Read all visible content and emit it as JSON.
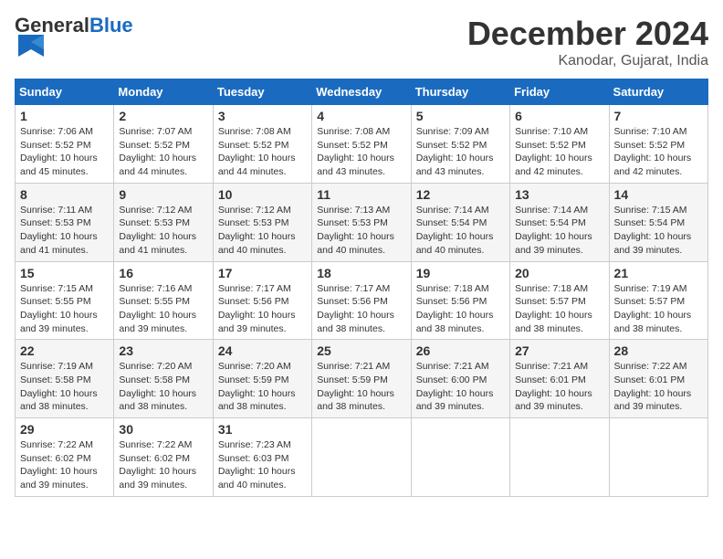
{
  "header": {
    "logo_general": "General",
    "logo_blue": "Blue",
    "month_title": "December 2024",
    "location": "Kanodar, Gujarat, India"
  },
  "calendar": {
    "days_of_week": [
      "Sunday",
      "Monday",
      "Tuesday",
      "Wednesday",
      "Thursday",
      "Friday",
      "Saturday"
    ],
    "weeks": [
      [
        null,
        null,
        null,
        null,
        null,
        null,
        null
      ]
    ],
    "cells": [
      {
        "date": 1,
        "dow": 0,
        "sunrise": "7:06 AM",
        "sunset": "5:52 PM",
        "daylight": "10 hours and 45 minutes."
      },
      {
        "date": 2,
        "dow": 1,
        "sunrise": "7:07 AM",
        "sunset": "5:52 PM",
        "daylight": "10 hours and 44 minutes."
      },
      {
        "date": 3,
        "dow": 2,
        "sunrise": "7:08 AM",
        "sunset": "5:52 PM",
        "daylight": "10 hours and 44 minutes."
      },
      {
        "date": 4,
        "dow": 3,
        "sunrise": "7:08 AM",
        "sunset": "5:52 PM",
        "daylight": "10 hours and 43 minutes."
      },
      {
        "date": 5,
        "dow": 4,
        "sunrise": "7:09 AM",
        "sunset": "5:52 PM",
        "daylight": "10 hours and 43 minutes."
      },
      {
        "date": 6,
        "dow": 5,
        "sunrise": "7:10 AM",
        "sunset": "5:52 PM",
        "daylight": "10 hours and 42 minutes."
      },
      {
        "date": 7,
        "dow": 6,
        "sunrise": "7:10 AM",
        "sunset": "5:52 PM",
        "daylight": "10 hours and 42 minutes."
      },
      {
        "date": 8,
        "dow": 0,
        "sunrise": "7:11 AM",
        "sunset": "5:53 PM",
        "daylight": "10 hours and 41 minutes."
      },
      {
        "date": 9,
        "dow": 1,
        "sunrise": "7:12 AM",
        "sunset": "5:53 PM",
        "daylight": "10 hours and 41 minutes."
      },
      {
        "date": 10,
        "dow": 2,
        "sunrise": "7:12 AM",
        "sunset": "5:53 PM",
        "daylight": "10 hours and 40 minutes."
      },
      {
        "date": 11,
        "dow": 3,
        "sunrise": "7:13 AM",
        "sunset": "5:53 PM",
        "daylight": "10 hours and 40 minutes."
      },
      {
        "date": 12,
        "dow": 4,
        "sunrise": "7:14 AM",
        "sunset": "5:54 PM",
        "daylight": "10 hours and 40 minutes."
      },
      {
        "date": 13,
        "dow": 5,
        "sunrise": "7:14 AM",
        "sunset": "5:54 PM",
        "daylight": "10 hours and 39 minutes."
      },
      {
        "date": 14,
        "dow": 6,
        "sunrise": "7:15 AM",
        "sunset": "5:54 PM",
        "daylight": "10 hours and 39 minutes."
      },
      {
        "date": 15,
        "dow": 0,
        "sunrise": "7:15 AM",
        "sunset": "5:55 PM",
        "daylight": "10 hours and 39 minutes."
      },
      {
        "date": 16,
        "dow": 1,
        "sunrise": "7:16 AM",
        "sunset": "5:55 PM",
        "daylight": "10 hours and 39 minutes."
      },
      {
        "date": 17,
        "dow": 2,
        "sunrise": "7:17 AM",
        "sunset": "5:56 PM",
        "daylight": "10 hours and 39 minutes."
      },
      {
        "date": 18,
        "dow": 3,
        "sunrise": "7:17 AM",
        "sunset": "5:56 PM",
        "daylight": "10 hours and 38 minutes."
      },
      {
        "date": 19,
        "dow": 4,
        "sunrise": "7:18 AM",
        "sunset": "5:56 PM",
        "daylight": "10 hours and 38 minutes."
      },
      {
        "date": 20,
        "dow": 5,
        "sunrise": "7:18 AM",
        "sunset": "5:57 PM",
        "daylight": "10 hours and 38 minutes."
      },
      {
        "date": 21,
        "dow": 6,
        "sunrise": "7:19 AM",
        "sunset": "5:57 PM",
        "daylight": "10 hours and 38 minutes."
      },
      {
        "date": 22,
        "dow": 0,
        "sunrise": "7:19 AM",
        "sunset": "5:58 PM",
        "daylight": "10 hours and 38 minutes."
      },
      {
        "date": 23,
        "dow": 1,
        "sunrise": "7:20 AM",
        "sunset": "5:58 PM",
        "daylight": "10 hours and 38 minutes."
      },
      {
        "date": 24,
        "dow": 2,
        "sunrise": "7:20 AM",
        "sunset": "5:59 PM",
        "daylight": "10 hours and 38 minutes."
      },
      {
        "date": 25,
        "dow": 3,
        "sunrise": "7:21 AM",
        "sunset": "5:59 PM",
        "daylight": "10 hours and 38 minutes."
      },
      {
        "date": 26,
        "dow": 4,
        "sunrise": "7:21 AM",
        "sunset": "6:00 PM",
        "daylight": "10 hours and 39 minutes."
      },
      {
        "date": 27,
        "dow": 5,
        "sunrise": "7:21 AM",
        "sunset": "6:01 PM",
        "daylight": "10 hours and 39 minutes."
      },
      {
        "date": 28,
        "dow": 6,
        "sunrise": "7:22 AM",
        "sunset": "6:01 PM",
        "daylight": "10 hours and 39 minutes."
      },
      {
        "date": 29,
        "dow": 0,
        "sunrise": "7:22 AM",
        "sunset": "6:02 PM",
        "daylight": "10 hours and 39 minutes."
      },
      {
        "date": 30,
        "dow": 1,
        "sunrise": "7:22 AM",
        "sunset": "6:02 PM",
        "daylight": "10 hours and 39 minutes."
      },
      {
        "date": 31,
        "dow": 2,
        "sunrise": "7:23 AM",
        "sunset": "6:03 PM",
        "daylight": "10 hours and 40 minutes."
      }
    ],
    "labels": {
      "sunrise": "Sunrise:",
      "sunset": "Sunset:",
      "daylight": "Daylight:"
    }
  }
}
